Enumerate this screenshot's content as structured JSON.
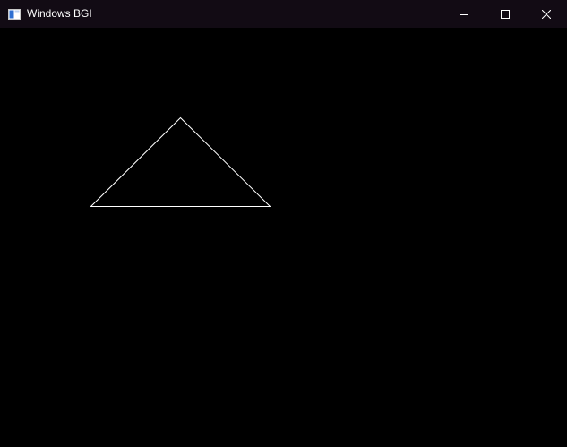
{
  "window": {
    "title": "Windows BGI",
    "icon": "window-app-icon",
    "controls": {
      "minimize_icon": "minimize-icon",
      "maximize_icon": "maximize-icon",
      "close_icon": "close-icon"
    }
  },
  "canvas": {
    "background_color": "#000000",
    "shapes": [
      {
        "type": "triangle",
        "stroke_color": "#ffffff"
      }
    ]
  },
  "colors": {
    "titlebar": "#120b14",
    "title_text": "#ffffff"
  }
}
